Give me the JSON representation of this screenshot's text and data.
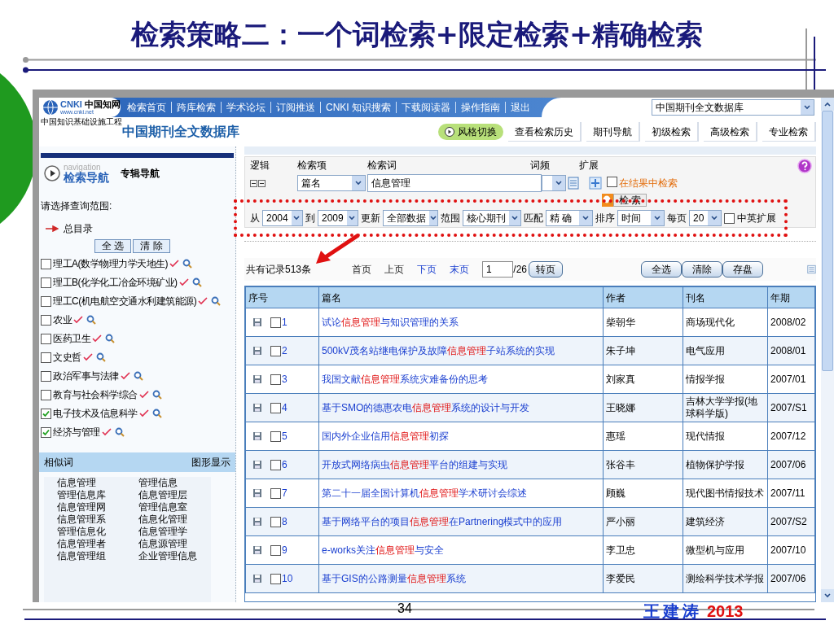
{
  "slide": {
    "title": "检索策略二：一个词检索+限定检索+精确检索",
    "page_number": "34",
    "author": "王建涛",
    "year": "2013"
  },
  "header": {
    "logo": "CNKI",
    "logo_cn": "中国知网",
    "logo_url": "www.cnki.net",
    "tagline": "中国知识基础设施工程",
    "nav": [
      "检索首页",
      "跨库检索",
      "学术论坛",
      "订阅推送",
      "CNKI 知识搜索",
      "下载阅读器",
      "操作指南",
      "退出"
    ],
    "database_select": "中国期刊全文数据库",
    "subtitle": "中国期刊全文数据库",
    "style_switch": "风格切换",
    "tabs": [
      "查看检索历史",
      "期刊导航",
      "初级检索",
      "高级检索",
      "专业检索"
    ]
  },
  "sidebar": {
    "nav_hint": "navigation",
    "nav_title": "检索导航",
    "alt_nav": "专辑导航",
    "scope_label": "请选择查询范围:",
    "root": "总目录",
    "buttons": [
      "全 选",
      "清 除"
    ],
    "categories": [
      {
        "label": "理工A(数学物理力学天地生)",
        "checked": false
      },
      {
        "label": "理工B(化学化工冶金环境矿业)",
        "checked": false
      },
      {
        "label": "理工C(机电航空交通水利建筑能源)",
        "checked": false
      },
      {
        "label": "农业",
        "checked": false
      },
      {
        "label": "医药卫生",
        "checked": false
      },
      {
        "label": "文史哲",
        "checked": false
      },
      {
        "label": "政治军事与法律",
        "checked": false
      },
      {
        "label": "教育与社会科学综合",
        "checked": false
      },
      {
        "label": "电子技术及信息科学",
        "checked": true
      },
      {
        "label": "经济与管理",
        "checked": true
      }
    ],
    "similar": {
      "title": "相似词",
      "graph": "图形显示",
      "words": [
        "信息管理",
        "管理信息",
        "管理信息库",
        "信息管理层",
        "信息管理网",
        "管理信息室",
        "信息管理系",
        "信息化管理",
        "管理信息化",
        "信息管理学",
        "信息管理者",
        "信息源管理",
        "信息管理组",
        "企业管理信息"
      ]
    }
  },
  "search": {
    "headers": [
      "逻辑",
      "检索项",
      "检索词",
      "词频",
      "扩展"
    ],
    "field": "篇名",
    "term": "信息管理",
    "in_results": {
      "label": "在结果中检索",
      "checked": false
    },
    "search_button": "检 索",
    "filters": [
      {
        "label": "从",
        "value": "2004"
      },
      {
        "label": "到",
        "value": "2009"
      },
      {
        "label": "更新",
        "value": "全部数据"
      },
      {
        "label": "范围",
        "value": "核心期刊"
      },
      {
        "label": "匹配",
        "value": "精 确"
      },
      {
        "label": "排序",
        "value": "时间"
      },
      {
        "label": "每页",
        "value": "20"
      }
    ],
    "bilingual": {
      "label": "中英扩展",
      "checked": false
    }
  },
  "results": {
    "count": "共有记录513条",
    "pager": [
      {
        "label": "首页",
        "disabled": true
      },
      {
        "label": "上页",
        "disabled": true
      },
      {
        "label": "下页",
        "disabled": false
      },
      {
        "label": "末页",
        "disabled": false
      }
    ],
    "page": "1",
    "total": "/26",
    "go": "转页",
    "actions": [
      "全选",
      "清除",
      "存盘"
    ]
  },
  "table": {
    "columns": [
      "序号",
      "篇名",
      "作者",
      "刊名",
      "年期"
    ],
    "rows": [
      {
        "no": "1",
        "checked": false,
        "before": "试论",
        "keyword": "信息管理",
        "after": "与知识管理的关系",
        "author": "柴朝华",
        "journal": "商场现代化",
        "issue": "2008/02"
      },
      {
        "no": "2",
        "checked": false,
        "before": "500kV茂名站继电保护及故障",
        "keyword": "信息管理",
        "after": "子站系统的实现",
        "author": "朱子坤",
        "journal": "电气应用",
        "issue": "2008/01"
      },
      {
        "no": "3",
        "checked": false,
        "before": "我国文献",
        "keyword": "信息管理",
        "after": "系统灾难备份的思考",
        "author": "刘家真",
        "journal": "情报学报",
        "issue": "2007/01"
      },
      {
        "no": "4",
        "checked": false,
        "before": "基于SMO的德惠农电",
        "keyword": "信息管理",
        "after": "系统的设计与开发",
        "author": "王晓娜",
        "journal": "吉林大学学报(地球科学版)",
        "issue": "2007/S1"
      },
      {
        "no": "5",
        "checked": false,
        "before": "国内外企业信用",
        "keyword": "信息管理",
        "after": "初探",
        "author": "惠瑶",
        "journal": "现代情报",
        "issue": "2007/12"
      },
      {
        "no": "6",
        "checked": false,
        "before": "开放式网络病虫",
        "keyword": "信息管理",
        "after": "平台的组建与实现",
        "author": "张谷丰",
        "journal": "植物保护学报",
        "issue": "2007/06"
      },
      {
        "no": "7",
        "checked": false,
        "before": "第二十一届全国计算机",
        "keyword": "信息管理",
        "after": "学术研讨会综述",
        "author": "顾巍",
        "journal": "现代图书情报技术",
        "issue": "2007/11"
      },
      {
        "no": "8",
        "checked": false,
        "before": "基于网络平台的项目",
        "keyword": "信息管理",
        "after": "在Partnering模式中的应用",
        "author": "严小丽",
        "journal": "建筑经济",
        "issue": "2007/S2"
      },
      {
        "no": "9",
        "checked": false,
        "before": "e-works关注",
        "keyword": "信息管理",
        "after": "与安全",
        "author": "李卫忠",
        "journal": "微型机与应用",
        "issue": "2007/10"
      },
      {
        "no": "10",
        "checked": false,
        "before": "基于GIS的公路测量",
        "keyword": "信息管理",
        "after": "系统",
        "author": "李爱民",
        "journal": "测绘科学技术学报",
        "issue": "2007/06"
      }
    ]
  }
}
